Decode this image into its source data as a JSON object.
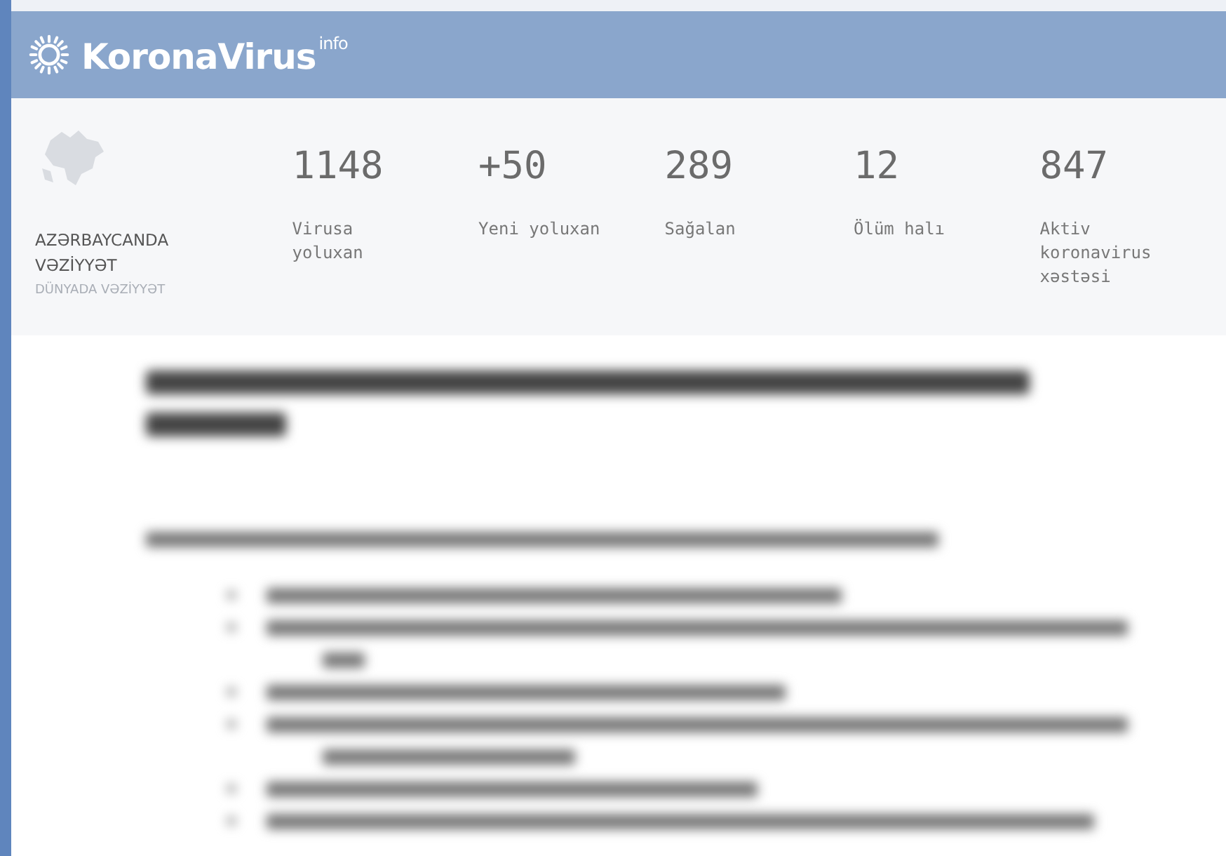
{
  "header": {
    "brand": "KoronaVirus",
    "brand_sup": "info"
  },
  "region": {
    "title": "AZƏRBAYCANDA VƏZİYYƏT",
    "world_link": "DÜNYADA VƏZİYYƏT"
  },
  "stats": [
    {
      "value": "1148",
      "label": "Virusa yoluxan"
    },
    {
      "value": "+50",
      "label": "Yeni yoluxan"
    },
    {
      "value": "289",
      "label": "Sağalan"
    },
    {
      "value": "12",
      "label": "Ölüm halı"
    },
    {
      "value": "847",
      "label": "Aktiv koronavirus xəstəsi"
    }
  ]
}
